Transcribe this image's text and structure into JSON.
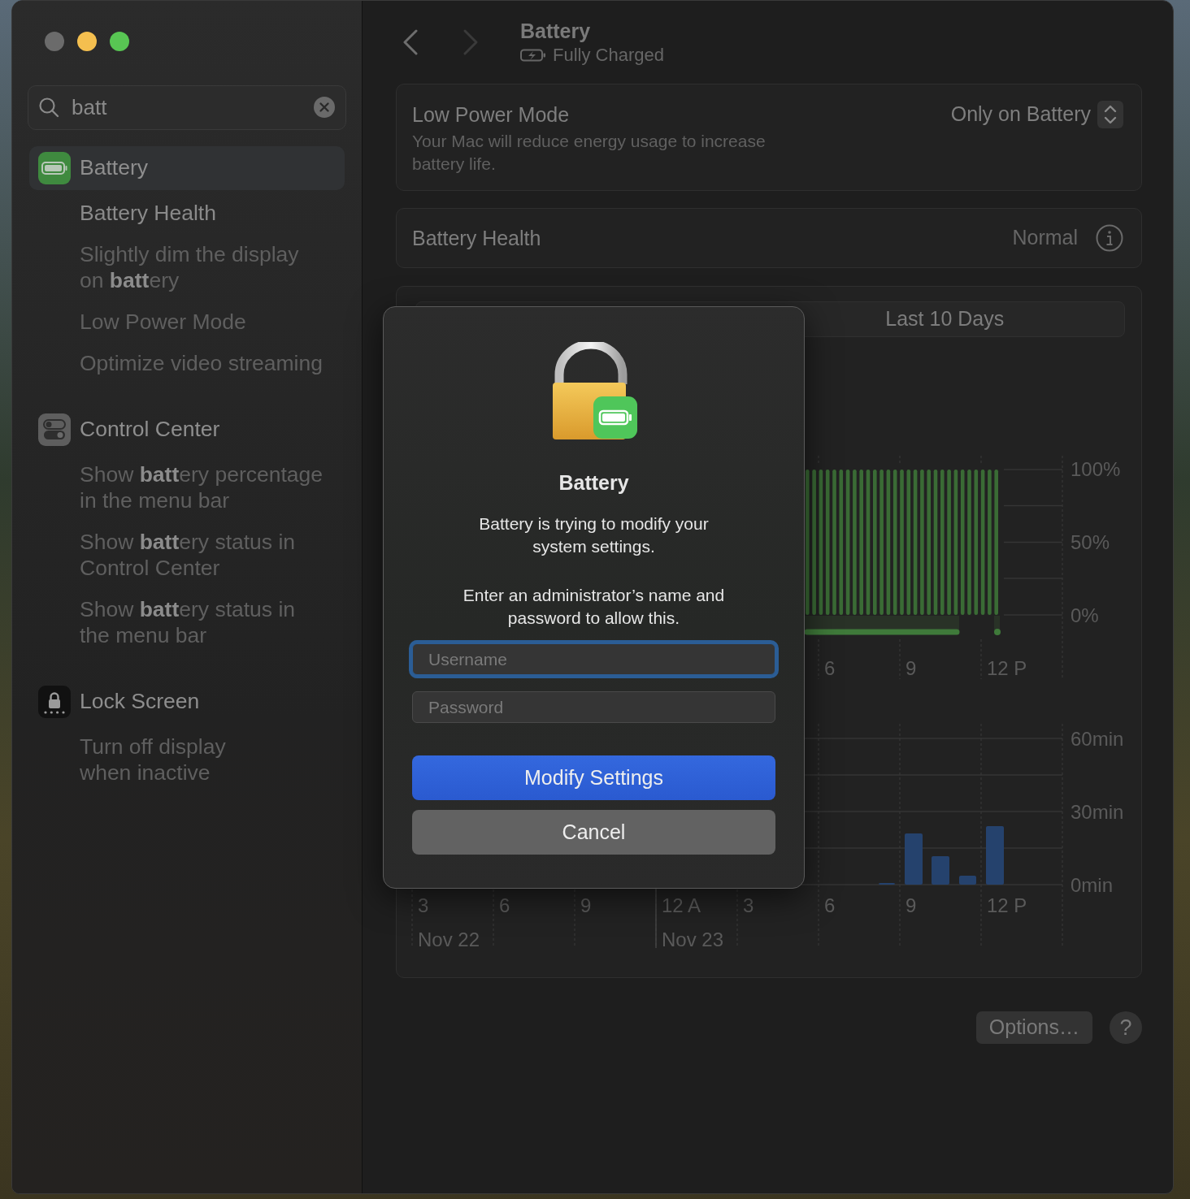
{
  "sidebar": {
    "search": {
      "value": "batt"
    },
    "groups": [
      {
        "label": "Battery",
        "selected": true,
        "children": [
          {
            "label": "Battery Health",
            "matched": true
          },
          {
            "label": "Slightly dim the display\non **batt**ery",
            "matched": false
          },
          {
            "label": "Low Power Mode",
            "matched": false
          },
          {
            "label": "Optimize video streaming",
            "matched": false
          }
        ]
      },
      {
        "label": "Control Center",
        "selected": false,
        "children": [
          {
            "label": "Show **batt**ery percentage\nin the menu bar",
            "matched": false
          },
          {
            "label": "Show **batt**ery status in\nControl Center",
            "matched": false
          },
          {
            "label": "Show **batt**ery status in\nthe menu bar",
            "matched": false
          }
        ]
      },
      {
        "label": "Lock Screen",
        "selected": false,
        "children": [
          {
            "label": "Turn off display\nwhen inactive",
            "matched": false
          }
        ]
      }
    ]
  },
  "header": {
    "title": "Battery",
    "subtitle": "Fully Charged",
    "back_disabled": false,
    "forward_disabled": true
  },
  "low_power_mode": {
    "title": "Low Power Mode",
    "description": "Your Mac will reduce energy usage to increase\nbattery life.",
    "value": "Only on Battery"
  },
  "battery_health": {
    "title": "Battery Health",
    "value": "Normal"
  },
  "usage": {
    "tabs": [
      {
        "label": "Last 10 Days",
        "selected": false
      }
    ],
    "level_chart": {
      "y_labels": [
        "100%",
        "50%",
        "0%"
      ],
      "x_labels": [
        "6",
        "9",
        "12 P"
      ]
    },
    "screen_chart": {
      "y_labels": [
        "60min",
        "30min",
        "0min"
      ],
      "x_labels": [
        "3",
        "6",
        "9",
        "12 A",
        "3",
        "6",
        "9",
        "12 P"
      ],
      "dates": [
        "Nov 22",
        "Nov 23"
      ]
    }
  },
  "footer": {
    "options": "Options…",
    "help": "?"
  },
  "dialog": {
    "title": "Battery",
    "message": "Battery is trying to modify your\nsystem settings.",
    "prompt": "Enter an administrator’s name and\npassword to allow this.",
    "username": {
      "placeholder": "Username",
      "focused": true
    },
    "password": {
      "placeholder": "Password",
      "focused": false
    },
    "buttons": [
      {
        "label": "Modify Settings",
        "kind": "primary"
      },
      {
        "label": "Cancel",
        "kind": "secondary"
      }
    ]
  }
}
